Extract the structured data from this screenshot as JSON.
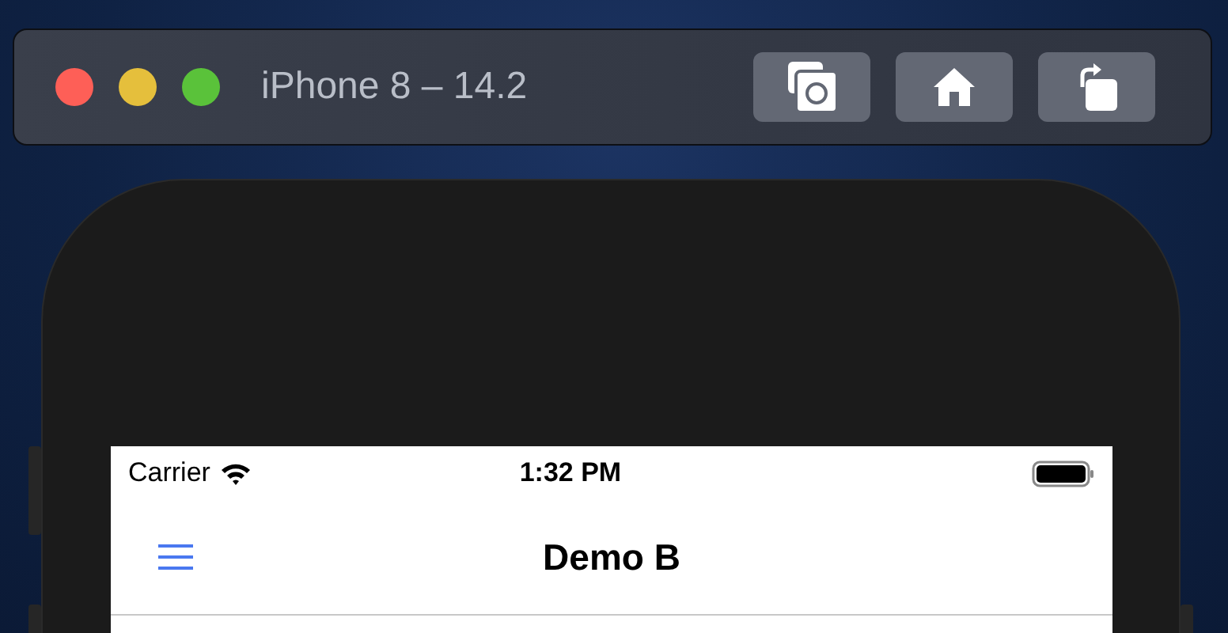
{
  "window": {
    "title": "iPhone 8 – 14.2",
    "traffic_lights": [
      {
        "color": "#fe5f57"
      },
      {
        "color": "#e5bf3c"
      },
      {
        "color": "#5ac23a"
      }
    ],
    "toolbar_buttons": [
      {
        "kind": "screenshot"
      },
      {
        "kind": "home"
      },
      {
        "kind": "rotate"
      }
    ]
  },
  "status_bar": {
    "carrier": "Carrier",
    "time": "1:32 PM"
  },
  "nav_bar": {
    "title": "Demo B"
  }
}
